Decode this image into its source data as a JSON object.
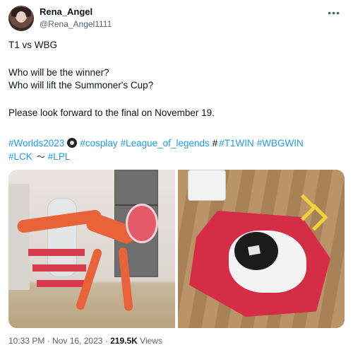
{
  "user": {
    "display_name": "Rena_Angel",
    "handle": "@Rena_Angel1111"
  },
  "tweet": {
    "lines": [
      "T1 vs WBG",
      "Who will be the winner?",
      "Who will lift the Summoner's Cup?",
      "Please look forward to the final on November 19."
    ],
    "hashtags": {
      "worlds": "#Worlds2023",
      "cosplay": "#cosplay",
      "lol": "#League_of_legends",
      "t1win_prefix": "#",
      "t1win": "#T1WIN",
      "wbgwin": "#WBGWIN",
      "lck": "#LCK",
      "lpl": "#LPL"
    }
  },
  "media": {
    "photos": [
      "cosplay-left-photo",
      "cosplay-right-photo"
    ]
  },
  "meta": {
    "time": "10:33 PM",
    "date": "Nov 16, 2023",
    "views_count": "219.5K",
    "views_label": "Views"
  },
  "colors": {
    "link": "#1d9bf0",
    "secondary_text": "#536471"
  },
  "icons": {
    "more": "more-horizontal-icon"
  }
}
